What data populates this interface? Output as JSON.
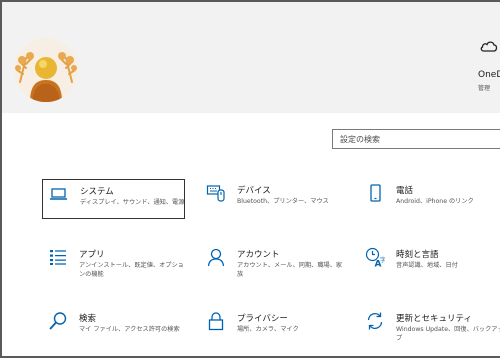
{
  "header": {
    "onedrive": {
      "title": "OneD",
      "subtitle": "管理"
    }
  },
  "search": {
    "placeholder": "設定の検索"
  },
  "tiles": [
    {
      "title": "システム",
      "desc": "ディスプレイ、サウンド、通知、電源",
      "icon": "laptop-icon",
      "selected": true
    },
    {
      "title": "デバイス",
      "desc": "Bluetooth、プリンター、マウス",
      "icon": "keyboard-devices-icon"
    },
    {
      "title": "電話",
      "desc": "Android、iPhone のリンク",
      "icon": "phone-icon"
    },
    {
      "title": "アプリ",
      "desc": "アンインストール、既定値、オプションの機能",
      "icon": "apps-list-icon"
    },
    {
      "title": "アカウント",
      "desc": "アカウント、メール、同期、職場、家族",
      "icon": "person-icon"
    },
    {
      "title": "時刻と言語",
      "desc": "音声認識、地域、日付",
      "icon": "time-language-icon"
    },
    {
      "title": "検索",
      "desc": "マイ ファイル、アクセス許可の検索",
      "icon": "search-icon"
    },
    {
      "title": "プライバシー",
      "desc": "場所、カメラ、マイク",
      "icon": "lock-icon"
    },
    {
      "title": "更新とセキュリティ",
      "desc": "Windows Update、回復、バックアップ",
      "icon": "update-sync-icon"
    }
  ],
  "colors": {
    "accent": "#0063b1",
    "header_bg": "#f2f2f2"
  }
}
